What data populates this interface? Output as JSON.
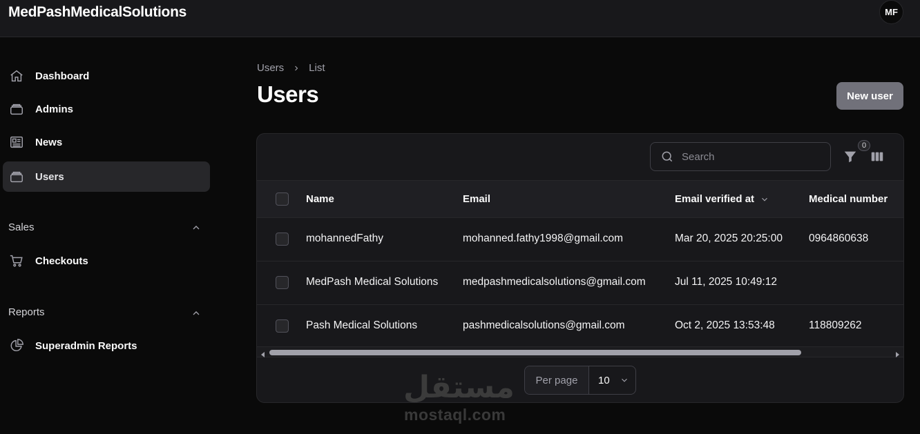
{
  "app": {
    "brand": "MedPashMedicalSolutions",
    "avatar_initials": "MF"
  },
  "sidebar": {
    "items": [
      {
        "label": "Dashboard",
        "icon": "home-icon"
      },
      {
        "label": "Admins",
        "icon": "stack-icon"
      },
      {
        "label": "News",
        "icon": "newspaper-icon"
      },
      {
        "label": "Users",
        "icon": "stack-icon",
        "active": true
      }
    ],
    "groups": [
      {
        "title": "Sales",
        "items": [
          {
            "label": "Checkouts",
            "icon": "cart-icon"
          }
        ]
      },
      {
        "title": "Reports",
        "items": [
          {
            "label": "Superadmin Reports",
            "icon": "pie-chart-icon"
          }
        ]
      }
    ]
  },
  "header": {
    "breadcrumb": [
      "Users",
      "List"
    ],
    "title": "Users",
    "new_button": "New user"
  },
  "table": {
    "search_placeholder": "Search",
    "filter_count": "0",
    "columns": [
      "Name",
      "Email",
      "Email verified at",
      "Medical number"
    ],
    "rows": [
      {
        "name": "mohannedFathy",
        "email": "mohanned.fathy1998@gmail.com",
        "verified": "Mar 20, 2025 20:25:00",
        "medical": "0964860638"
      },
      {
        "name": "MedPash Medical Solutions",
        "email": "medpashmedicalsolutions@gmail.com",
        "verified": "Jul 11, 2025 10:49:12",
        "medical": ""
      },
      {
        "name": "Pash Medical Solutions",
        "email": "pashmedicalsolutions@gmail.com",
        "verified": "Oct 2, 2025 13:53:48",
        "medical": "118809262"
      }
    ],
    "per_page_label": "Per page",
    "per_page_value": "10"
  },
  "watermark": {
    "arabic": "مستقل",
    "latin": "mostaql.com"
  },
  "colors": {
    "background": "#0a0a0a",
    "surface": "#18181b",
    "button": "#71717a"
  }
}
